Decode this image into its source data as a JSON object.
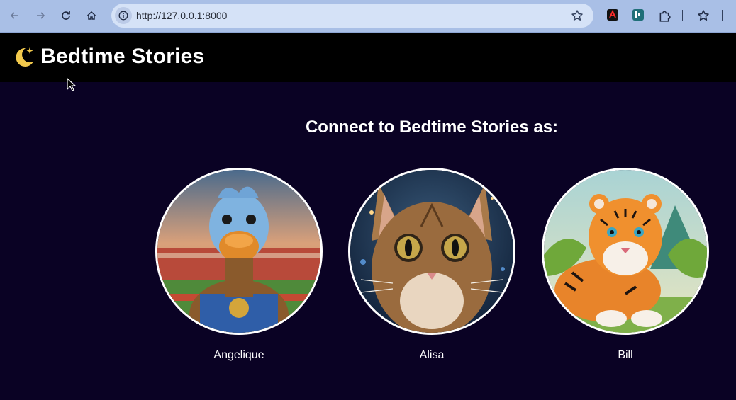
{
  "browser": {
    "url": "http://127.0.0.1:8000",
    "back_icon": "arrow-left-icon",
    "forward_icon": "arrow-right-icon",
    "reload_icon": "reload-icon",
    "home_icon": "home-icon",
    "extensions": [
      "acrobat-extension-icon",
      "teal-extension-icon",
      "puzzle-extensions-icon"
    ],
    "bookmark_icon": "star-icon"
  },
  "app": {
    "title": "Bedtime Stories",
    "logo_icon": "moon-sparkle-icon",
    "accent": "#f2c94c",
    "background": "#0a0224"
  },
  "main": {
    "heading": "Connect to Bedtime Stories as:",
    "profiles": [
      {
        "name": "Angelique",
        "avatar": "duck-avatar"
      },
      {
        "name": "Alisa",
        "avatar": "cat-avatar"
      },
      {
        "name": "Bill",
        "avatar": "tiger-avatar"
      }
    ]
  }
}
